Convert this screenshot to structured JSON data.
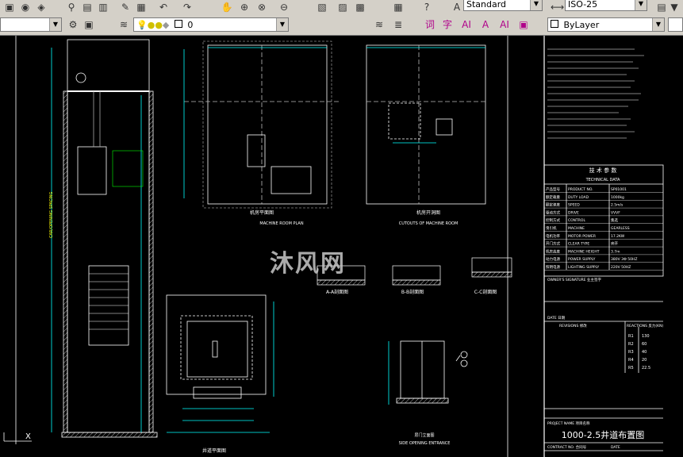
{
  "toolbar": {
    "text_style": "Standard",
    "dim_style": "ISO-25",
    "layer_name": "0",
    "linetype": "ByLayer",
    "text_icons": [
      "词",
      "字",
      "AI",
      "A",
      "AI"
    ]
  },
  "drawing": {
    "watermark": "沐风网",
    "machine_room_plan_cn": "机房平面图",
    "machine_room_plan_en": "MACHINE ROOM PLAN",
    "cutouts_cn": "机房开洞图",
    "cutouts_en": "CUTOUTS OF MACHINE ROOM",
    "section_a": "A-A剖面图",
    "section_b": "B-B剖面图",
    "section_c": "C-C剖面图",
    "landing_door": "层门立面图",
    "landing_door_en": "SIDE OPENING ENTRANCE",
    "hoistway_plan": "井道平面图",
    "tech_title_cn": "技 术 参 数",
    "tech_title_en": "TECHNICAL DATA",
    "tech_rows": [
      [
        "产品型号",
        "PRODUCT NO.",
        "SP01001"
      ],
      [
        "额定载重",
        "DUTY LOAD",
        "1000kg"
      ],
      [
        "额定速度",
        "SPEED",
        "2.5m/s"
      ],
      [
        "驱动方式",
        "DRIVE",
        "VVVF"
      ],
      [
        "控制方式",
        "CONTROL",
        "集选"
      ],
      [
        "曳引机",
        "MACHINE",
        "GEARLESS"
      ],
      [
        "电机功率",
        "MOTOR POWER",
        "17.2KW"
      ],
      [
        "开门方式",
        "CLEAR TYPE",
        "旁开"
      ],
      [
        "机房高度",
        "MACHINE HEIGHT",
        "3.7m"
      ],
      [
        "动力电源",
        "POWER SUPPLY",
        "380V 3Ф 50HZ"
      ],
      [
        "照明电源",
        "LIGHTING SUPPLY",
        "220V 50HZ"
      ]
    ],
    "signature_row": "OWNER'S SIGNATURE 业主签字",
    "date_row": "DATE 日期",
    "revisions_label": "REVISIONS 修改",
    "reactions_label": "REACTIONS 反力(KN)",
    "project_name": "PROJECT NAME 项目名称",
    "drawing_title": "1000-2.5井道布置图",
    "contract_no": "CONTRACT NO. 合同号",
    "date_label": "DATE",
    "reactions": [
      [
        "R1",
        "130"
      ],
      [
        "R2",
        "60"
      ],
      [
        "R3",
        "40"
      ],
      [
        "R4",
        "20"
      ],
      [
        "R5",
        "22.5"
      ]
    ]
  }
}
